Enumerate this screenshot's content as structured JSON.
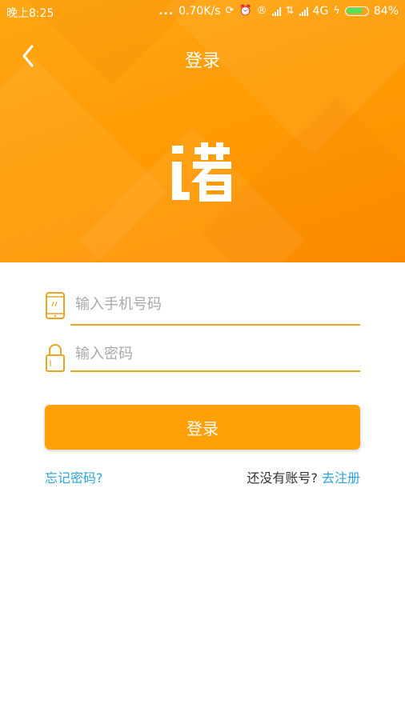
{
  "status_bar": {
    "time": "晚上8:25",
    "dots": "...",
    "network_speed": "0.70K/s",
    "network_type": "4G",
    "battery_percent": "84%",
    "battery_level": 0.84,
    "battery_color": "#55e05a"
  },
  "header": {
    "title": "登录",
    "logo_char": "诺",
    "colors": {
      "top": "#ffa714",
      "bottom": "#ff8f00"
    }
  },
  "form": {
    "phone": {
      "placeholder": "输入手机号码",
      "value": "",
      "icon": "phone-icon"
    },
    "password": {
      "placeholder": "输入密码",
      "value": "",
      "icon": "lock-icon"
    },
    "underline_color": "#e9a520",
    "icon_color": "#e9a520"
  },
  "login_button": {
    "label": "登录",
    "color": "#ffa106"
  },
  "links": {
    "forgot_password": "忘记密码?",
    "no_account": "还没有账号? ",
    "register": "去注册",
    "link_color": "#2ca3d9"
  }
}
